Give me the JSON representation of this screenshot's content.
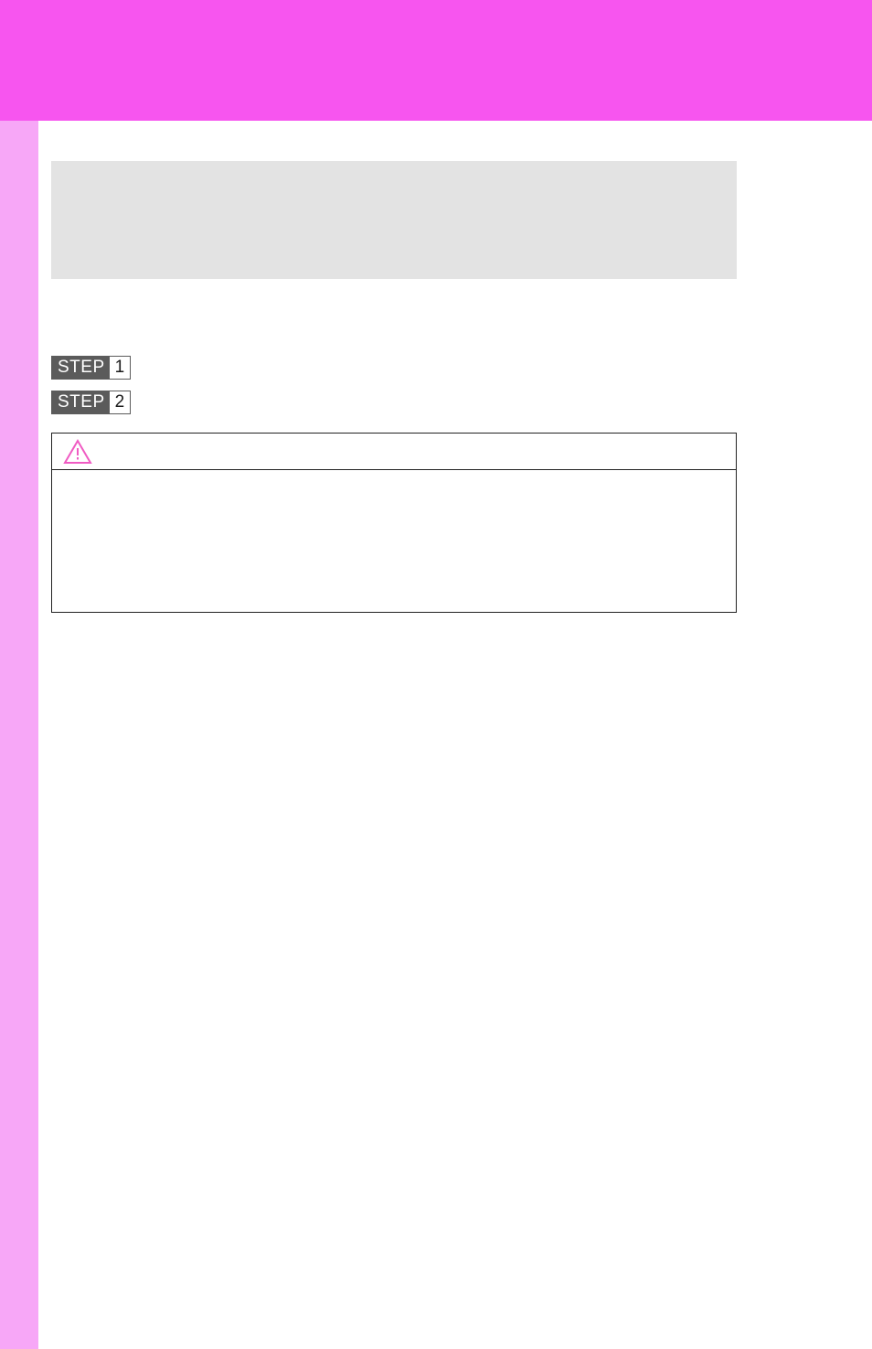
{
  "steps": [
    {
      "word": "STEP",
      "num": "1",
      "text": ""
    },
    {
      "word": "STEP",
      "num": "2",
      "text": ""
    }
  ],
  "caution": {
    "title": "",
    "body": ""
  }
}
